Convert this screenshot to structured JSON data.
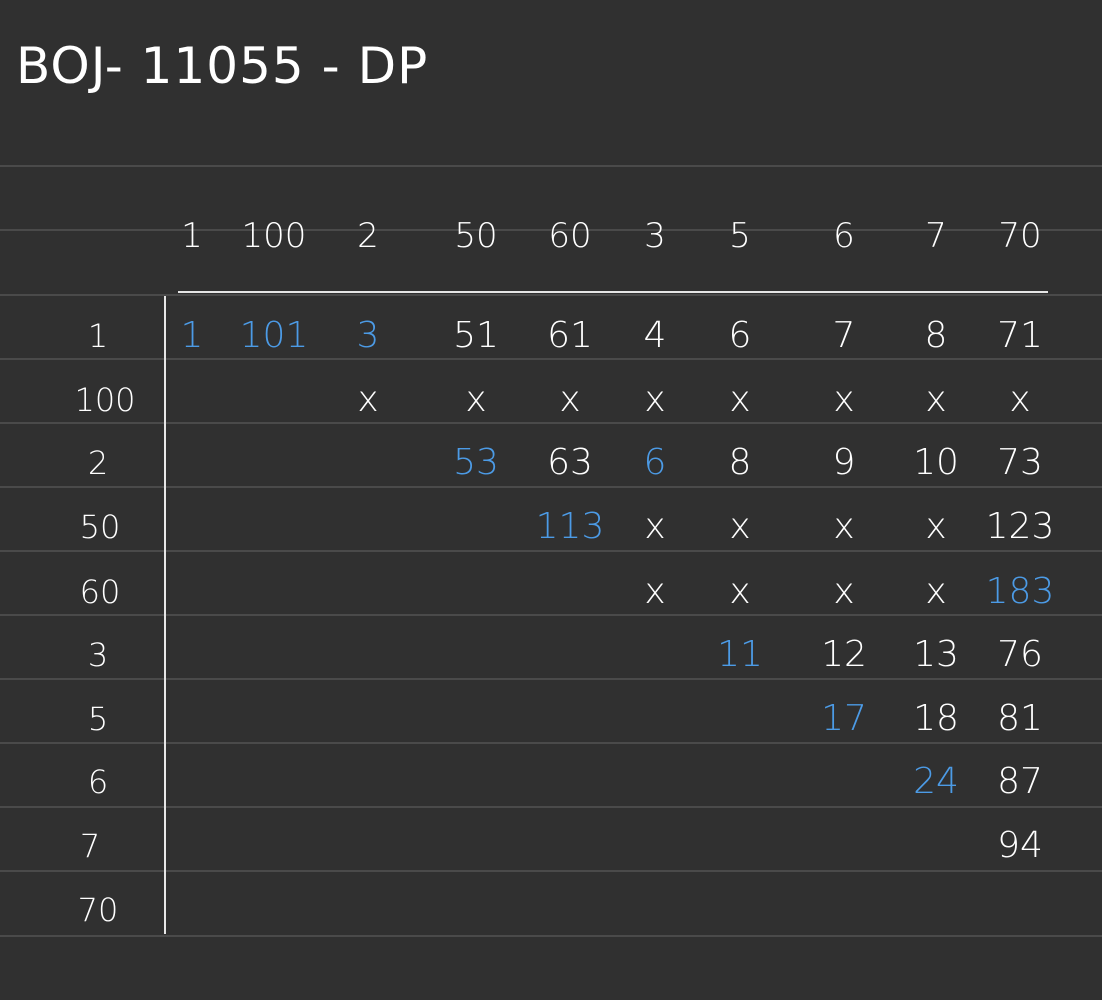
{
  "title": "BOJ- 11055 - DP",
  "accent_color": "#4c9be6",
  "columns": [
    "1",
    "100",
    "2",
    "50",
    "60",
    "3",
    "5",
    "6",
    "7",
    "70"
  ],
  "rows": [
    "1",
    "100",
    "2",
    "50",
    "60",
    "3",
    "5",
    "6",
    "7",
    "70"
  ],
  "grid": [
    [
      {
        "v": "1",
        "blue": true
      },
      {
        "v": "101",
        "blue": true
      },
      {
        "v": "3",
        "blue": true
      },
      {
        "v": "51"
      },
      {
        "v": "61"
      },
      {
        "v": "4"
      },
      {
        "v": "6"
      },
      {
        "v": "7"
      },
      {
        "v": "8"
      },
      {
        "v": "71"
      }
    ],
    [
      null,
      null,
      {
        "v": "x"
      },
      {
        "v": "x"
      },
      {
        "v": "x"
      },
      {
        "v": "x"
      },
      {
        "v": "x"
      },
      {
        "v": "x"
      },
      {
        "v": "x"
      },
      {
        "v": "x"
      }
    ],
    [
      null,
      null,
      null,
      {
        "v": "53",
        "blue": true
      },
      {
        "v": "63"
      },
      {
        "v": "6",
        "blue": true
      },
      {
        "v": "8"
      },
      {
        "v": "9"
      },
      {
        "v": "10"
      },
      {
        "v": "73"
      }
    ],
    [
      null,
      null,
      null,
      null,
      {
        "v": "113",
        "blue": true
      },
      {
        "v": "x"
      },
      {
        "v": "x"
      },
      {
        "v": "x"
      },
      {
        "v": "x"
      },
      {
        "v": "123"
      }
    ],
    [
      null,
      null,
      null,
      null,
      null,
      {
        "v": "x"
      },
      {
        "v": "x"
      },
      {
        "v": "x"
      },
      {
        "v": "x"
      },
      {
        "v": "183",
        "blue": true
      }
    ],
    [
      null,
      null,
      null,
      null,
      null,
      null,
      {
        "v": "11",
        "blue": true
      },
      {
        "v": "12"
      },
      {
        "v": "13"
      },
      {
        "v": "76"
      }
    ],
    [
      null,
      null,
      null,
      null,
      null,
      null,
      null,
      {
        "v": "17",
        "blue": true
      },
      {
        "v": "18"
      },
      {
        "v": "81"
      }
    ],
    [
      null,
      null,
      null,
      null,
      null,
      null,
      null,
      null,
      {
        "v": "24",
        "blue": true
      },
      {
        "v": "87"
      }
    ],
    [
      null,
      null,
      null,
      null,
      null,
      null,
      null,
      null,
      null,
      {
        "v": "94"
      }
    ],
    [
      null,
      null,
      null,
      null,
      null,
      null,
      null,
      null,
      null,
      null
    ]
  ]
}
